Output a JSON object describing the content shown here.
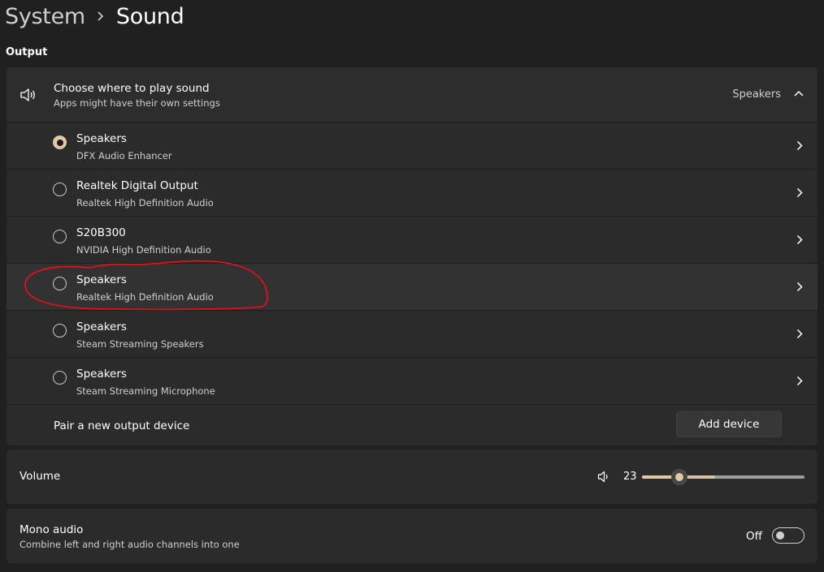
{
  "breadcrumb": {
    "parent": "System",
    "current": "Sound"
  },
  "output": {
    "section_label": "Output",
    "header": {
      "icon": "speaker-icon",
      "title": "Choose where to play sound",
      "subtitle": "Apps might have their own settings",
      "selected_value": "Speakers",
      "expanded": true
    },
    "devices": [
      {
        "name": "Speakers",
        "description": "DFX Audio Enhancer",
        "selected": true
      },
      {
        "name": "Realtek Digital Output",
        "description": "Realtek High Definition Audio",
        "selected": false
      },
      {
        "name": "S20B300",
        "description": "NVIDIA High Definition Audio",
        "selected": false
      },
      {
        "name": "Speakers",
        "description": "Realtek High Definition Audio",
        "selected": false,
        "annotated": true
      },
      {
        "name": "Speakers",
        "description": "Steam Streaming Speakers",
        "selected": false
      },
      {
        "name": "Speakers",
        "description": "Steam Streaming Microphone",
        "selected": false
      }
    ],
    "pair": {
      "label": "Pair a new output device",
      "button_label": "Add device"
    }
  },
  "volume": {
    "label": "Volume",
    "icon": "volume-icon",
    "value": "23",
    "level_percent": 23,
    "hover_fill_percent": 45
  },
  "mono": {
    "title": "Mono audio",
    "subtitle": "Combine left and right audio channels into one",
    "state_label": "Off",
    "enabled": false
  },
  "colors": {
    "background": "#202020",
    "card": "#2b2b2b",
    "accent": "#e3c8a4",
    "annotation": "#e0101a"
  }
}
